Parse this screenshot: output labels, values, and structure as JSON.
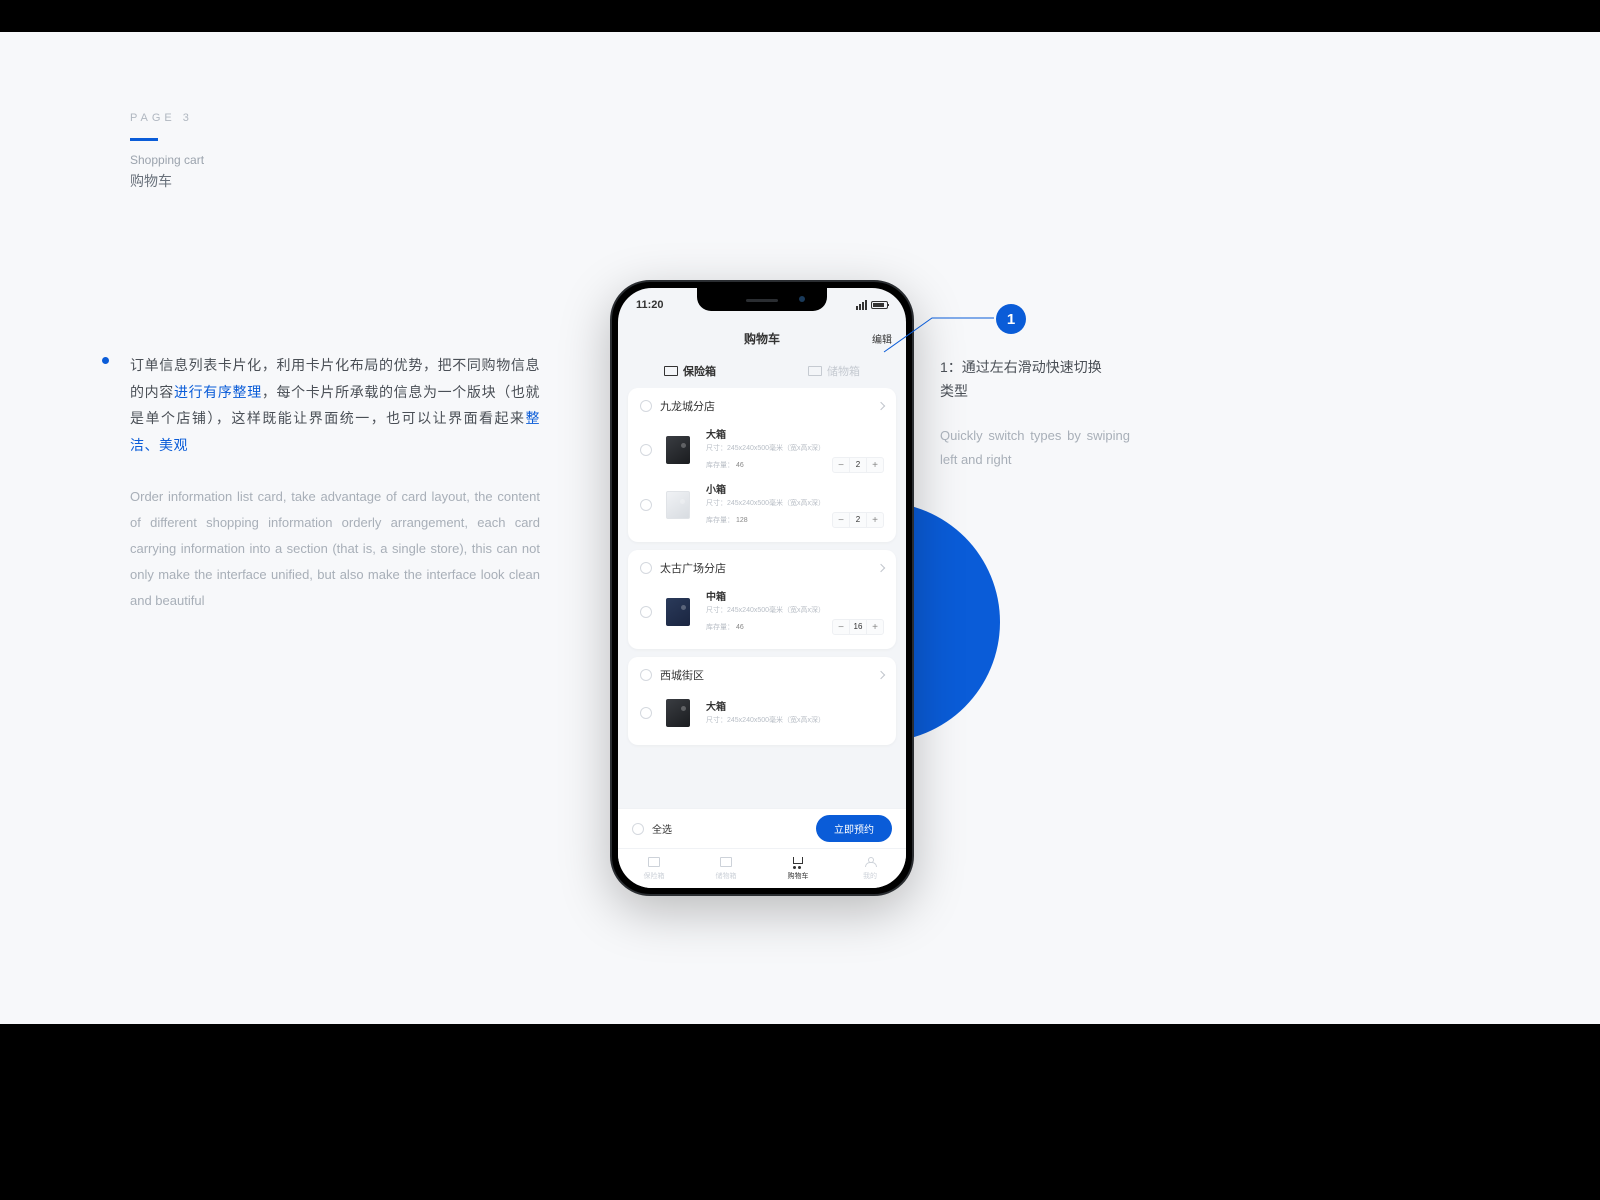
{
  "header": {
    "page_num": "PAGE 3",
    "sub_en": "Shopping cart",
    "sub_cn": "购物车"
  },
  "left": {
    "cn_parts": [
      "订单信息列表卡片化，利用卡片化布局的优势，把不同购物信息的内容",
      "进行有序整理",
      "，每个卡片所承载的信息为一个版块（也就是单个店铺），这样既能让界面统一，也可以让界面看起来",
      "整洁、美观"
    ],
    "en": "Order information list card, take advantage of card layout, the content of different shopping information orderly arrangement, each card carrying information into a section (that is, a single store), this can not only make the interface unified, but also make the interface look clean and beautiful"
  },
  "phone": {
    "time": "11:20",
    "title": "购物车",
    "edit": "编辑",
    "tabs": [
      {
        "label": "保险箱",
        "active": true
      },
      {
        "label": "储物箱",
        "active": false
      }
    ],
    "stores": [
      {
        "name": "九龙城分店",
        "items": [
          {
            "name": "大箱",
            "spec": "尺寸：245x240x500毫米（宽x高x深）",
            "stock_label": "库存量：",
            "stock": "46",
            "qty": "2",
            "tone": "dark"
          },
          {
            "name": "小箱",
            "spec": "尺寸：245x240x500毫米（宽x高x深）",
            "stock_label": "库存量：",
            "stock": "128",
            "qty": "2",
            "tone": "light"
          }
        ]
      },
      {
        "name": "太古广场分店",
        "items": [
          {
            "name": "中箱",
            "spec": "尺寸：245x240x500毫米（宽x高x深）",
            "stock_label": "库存量：",
            "stock": "46",
            "qty": "16",
            "tone": "blue"
          }
        ]
      },
      {
        "name": "西城街区",
        "items": [
          {
            "name": "大箱",
            "spec": "尺寸：245x240x500毫米（宽x高x深）",
            "stock_label": "",
            "stock": "",
            "qty": "",
            "tone": "dark"
          }
        ]
      }
    ],
    "select_all": "全选",
    "book": "立即预约",
    "tabbar": [
      {
        "label": "保险箱"
      },
      {
        "label": "储物箱"
      },
      {
        "label": "购物车"
      },
      {
        "label": "我的"
      }
    ]
  },
  "callout": {
    "num": "1",
    "title": "1：通过左右滑动快速切换类型",
    "en": "Quickly switch types by swiping left and right"
  }
}
